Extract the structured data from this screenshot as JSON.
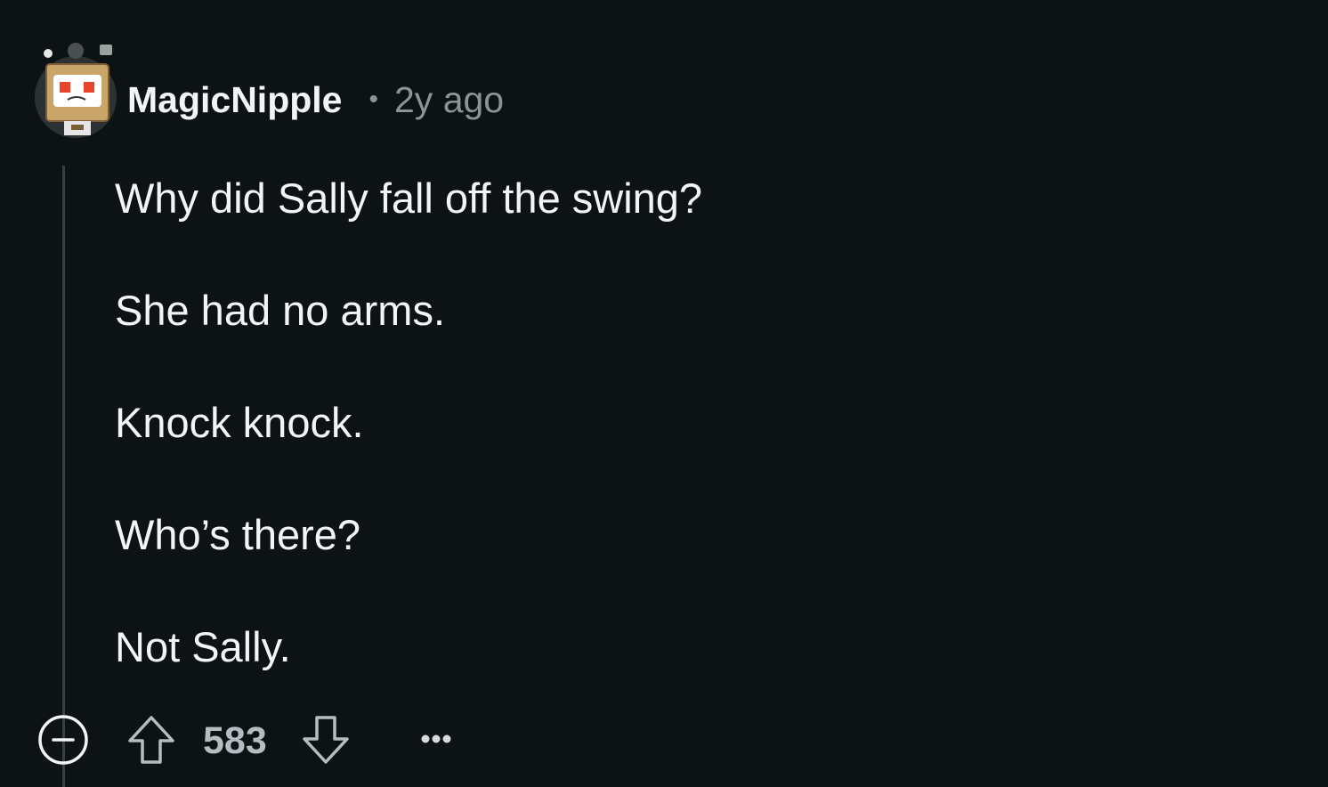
{
  "comment": {
    "author": "MagicNipple",
    "separator": "•",
    "timestamp": "2y ago",
    "paragraphs": [
      "Why did Sally fall off the swing?",
      "She had no arms.",
      "Knock knock.",
      "Who’s there?",
      "Not Sally."
    ],
    "score": "583"
  },
  "icons": {
    "avatar": "snoo-avatar",
    "collapse": "collapse-minus-icon",
    "upvote": "upvote-arrow-icon",
    "downvote": "downvote-arrow-icon",
    "more": "more-options-icon"
  },
  "colors": {
    "background": "#0d1314",
    "text": "#f2f4f5",
    "muted": "#8a9599",
    "score": "#b4bec2",
    "thread_line": "#3a3f42"
  }
}
